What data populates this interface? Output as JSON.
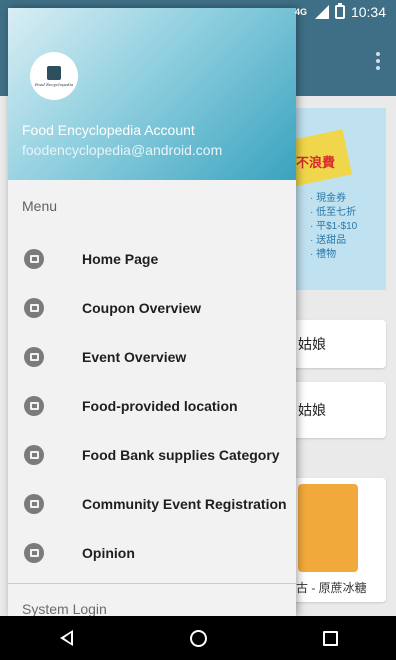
{
  "status_bar": {
    "network_label": "4G",
    "time": "10:34"
  },
  "background_app": {
    "banner": {
      "headline": "不浪費",
      "items": [
        "現金券",
        "低至七折",
        "平$1-$10",
        "送甜品",
        "禮物"
      ]
    },
    "cards": [
      {
        "label": "姑娘"
      },
      {
        "label": "姑娘"
      }
    ],
    "product": {
      "caption": "古 - 原蔗冰糖"
    }
  },
  "drawer": {
    "logo_text": "Food Encyclopedia",
    "account_name": "Food Encyclopedia Account",
    "account_email": "foodencyclopedia@android.com",
    "menu_heading": "Menu",
    "menu_items": [
      {
        "label": "Home Page",
        "icon": "store-icon"
      },
      {
        "label": "Coupon Overview",
        "icon": "coupon-icon"
      },
      {
        "label": "Event Overview",
        "icon": "document-icon"
      },
      {
        "label": "Food-provided location",
        "icon": "truck-icon"
      },
      {
        "label": "Food Bank supplies Category",
        "icon": "cart-icon"
      },
      {
        "label": "Community Event Registration",
        "icon": "edit-icon"
      },
      {
        "label": "Opinion",
        "icon": "search-icon"
      }
    ],
    "footer_item": "System Login"
  }
}
